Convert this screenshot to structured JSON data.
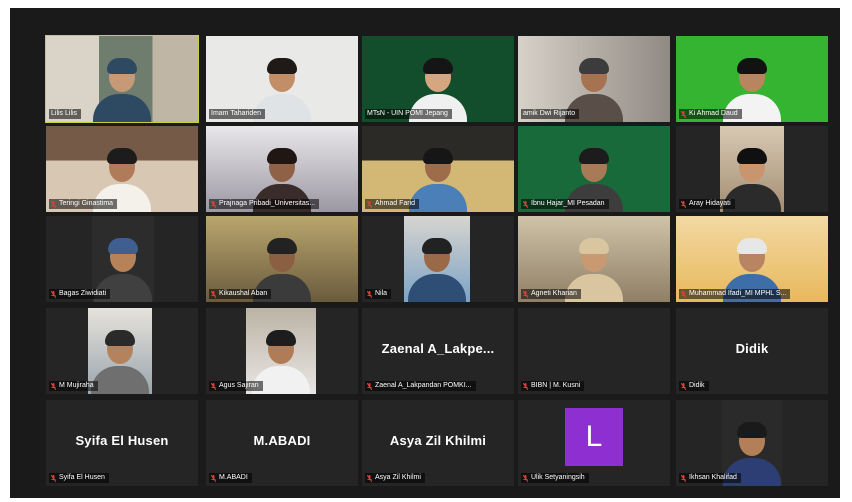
{
  "colors": {
    "background": "#1a1a1a",
    "tile": "#252525",
    "active_speaker_border": "#c8d13b",
    "muted_mic": "#e23c3c",
    "initial_avatar": "#8e2fd1"
  },
  "participants": [
    {
      "name": "Lilis Lilis",
      "video": true,
      "muted": false,
      "active": true
    },
    {
      "name": "Imam Tahariden",
      "video": true,
      "muted": false
    },
    {
      "name": "MTsN - UIN POMI Jepang",
      "video": true,
      "muted": false
    },
    {
      "name": "amik Dwi Rijanto",
      "video": true,
      "muted": false
    },
    {
      "name": "Ki Ahmad Daud",
      "video": true,
      "muted": true
    },
    {
      "name": "Teringi Ginastima",
      "video": true,
      "muted": true
    },
    {
      "name": "Prajnaga Pribadi_Universitas...",
      "video": true,
      "muted": true
    },
    {
      "name": "Ahmad Farid",
      "video": true,
      "muted": true
    },
    {
      "name": "Ibnu Hajar_MI Pesadan",
      "video": true,
      "muted": true
    },
    {
      "name": "Aray Hidayati",
      "video": true,
      "muted": true
    },
    {
      "name": "Bagas Ziwidiati",
      "video": true,
      "muted": true
    },
    {
      "name": "Kikaushal Aban",
      "video": true,
      "muted": true
    },
    {
      "name": "Nila",
      "video": true,
      "muted": true
    },
    {
      "name": "Agneti Kharian",
      "video": true,
      "muted": true
    },
    {
      "name": "Muhammad Ifadi_MI MPHL S...",
      "video": true,
      "muted": true
    },
    {
      "name": "M Mujiraha",
      "video": true,
      "muted": true
    },
    {
      "name": "Agus Sajiran",
      "video": true,
      "muted": true
    },
    {
      "name": "Zaenal A_Lakpandan POMKI...",
      "display_name": "Zaenal  A_Lakpe...",
      "video": false,
      "muted": true
    },
    {
      "name": "BIBN | M. Kusni",
      "video": false,
      "muted": true
    },
    {
      "name": "Didik",
      "display_name": "Didik",
      "video": false,
      "muted": true
    },
    {
      "name": "Syifa El Husen",
      "display_name": "Syifa El Husen",
      "video": false,
      "muted": true
    },
    {
      "name": "M.ABADI",
      "display_name": "M.ABADI",
      "video": false,
      "muted": true
    },
    {
      "name": "Asya Zil Khilmi",
      "display_name": "Asya Zil Khilmi",
      "video": false,
      "muted": true
    },
    {
      "name": "Ulik Setyaningsih",
      "initial": "L",
      "video": false,
      "muted": true
    },
    {
      "name": "Ikhsan Khalifad",
      "video": true,
      "muted": true
    }
  ]
}
